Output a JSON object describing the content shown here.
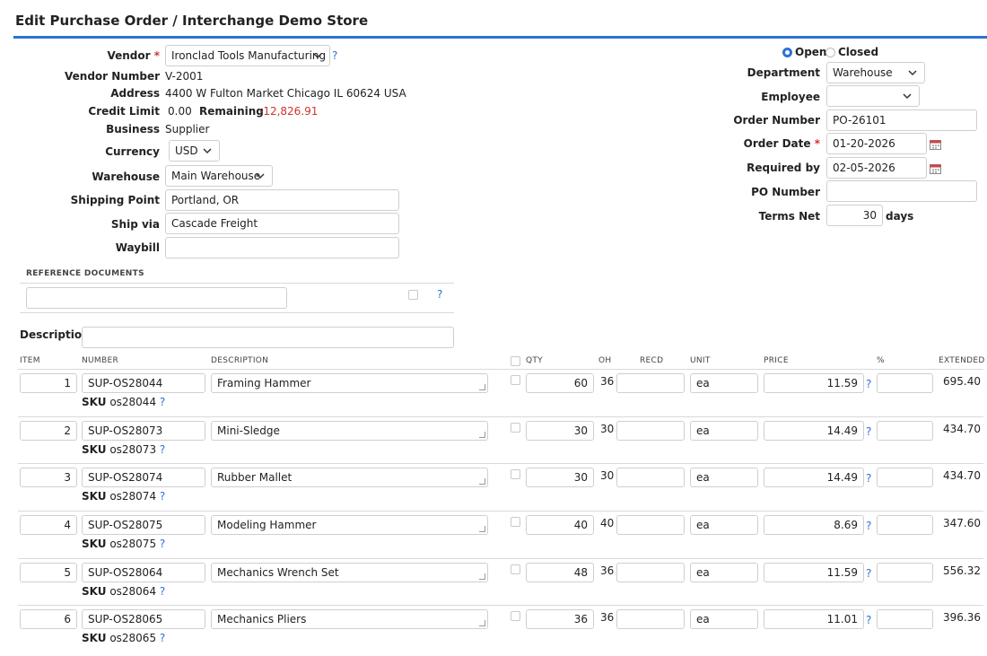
{
  "page": {
    "title": "Edit Purchase Order / Interchange Demo Store"
  },
  "vendor": {
    "vendor_label": "Vendor",
    "required_mark": "*",
    "vendor_value": "Ironclad Tools Manufacturing",
    "help": "?",
    "number_label": "Vendor Number",
    "number_value": "V-2001",
    "address_label": "Address",
    "address_value": "4400 W Fulton Market Chicago IL 60624 USA",
    "credit_label": "Credit Limit",
    "credit_value": "0.00",
    "remaining_label": "Remaining",
    "remaining_value": "-12,826.91",
    "business_label": "Business",
    "business_value": "Supplier",
    "currency_label": "Currency",
    "currency_value": "USD",
    "warehouse_label": "Warehouse",
    "warehouse_value": "Main Warehouse",
    "shipping_label": "Shipping Point",
    "shipping_value": "Portland, OR",
    "shipvia_label": "Ship via",
    "shipvia_value": "Cascade Freight",
    "waybill_label": "Waybill",
    "waybill_value": ""
  },
  "order": {
    "status_open": "Open",
    "status_closed": "Closed",
    "department_label": "Department",
    "department_value": "Warehouse",
    "employee_label": "Employee",
    "employee_value": "",
    "order_number_label": "Order Number",
    "order_number_value": "PO-26101",
    "order_date_label": "Order Date",
    "order_date_value": "01-20-2026",
    "required_by_label": "Required by",
    "required_by_value": "02-05-2026",
    "po_number_label": "PO Number",
    "po_number_value": "",
    "terms_label": "Terms Net",
    "terms_value": "30",
    "terms_unit": "days"
  },
  "reference": {
    "heading": "REFERENCE DOCUMENTS",
    "value": "",
    "help": "?",
    "description_label": "Description",
    "description_value": ""
  },
  "lines": {
    "headers": {
      "item": "ITEM",
      "number": "NUMBER",
      "description": "DESCRIPTION",
      "qty": "QTY",
      "oh": "OH",
      "recd": "RECD",
      "unit": "UNIT",
      "price": "PRICE",
      "pct": "%",
      "extended": "EXTENDED"
    },
    "sku_label": "SKU",
    "help": "?",
    "rows": [
      {
        "item": "1",
        "number": "SUP-OS28044",
        "description": "Framing Hammer",
        "qty": "60",
        "oh": "36",
        "recd": "",
        "unit": "ea",
        "price": "11.59",
        "pct": "",
        "extended": "695.40",
        "sku": "os28044"
      },
      {
        "item": "2",
        "number": "SUP-OS28073",
        "description": "Mini-Sledge",
        "qty": "30",
        "oh": "30",
        "recd": "",
        "unit": "ea",
        "price": "14.49",
        "pct": "",
        "extended": "434.70",
        "sku": "os28073"
      },
      {
        "item": "3",
        "number": "SUP-OS28074",
        "description": "Rubber Mallet",
        "qty": "30",
        "oh": "30",
        "recd": "",
        "unit": "ea",
        "price": "14.49",
        "pct": "",
        "extended": "434.70",
        "sku": "os28074"
      },
      {
        "item": "4",
        "number": "SUP-OS28075",
        "description": "Modeling Hammer",
        "qty": "40",
        "oh": "40",
        "recd": "",
        "unit": "ea",
        "price": "8.69",
        "pct": "",
        "extended": "347.60",
        "sku": "os28075"
      },
      {
        "item": "5",
        "number": "SUP-OS28064",
        "description": "Mechanics Wrench Set",
        "qty": "48",
        "oh": "36",
        "recd": "",
        "unit": "ea",
        "price": "11.59",
        "pct": "",
        "extended": "556.32",
        "sku": "os28064"
      },
      {
        "item": "6",
        "number": "SUP-OS28065",
        "description": "Mechanics Pliers",
        "qty": "36",
        "oh": "36",
        "recd": "",
        "unit": "ea",
        "price": "11.01",
        "pct": "",
        "extended": "396.36",
        "sku": "os28065"
      }
    ]
  },
  "colors": {
    "accent": "#2a73d4",
    "negative": "#d0342c"
  }
}
